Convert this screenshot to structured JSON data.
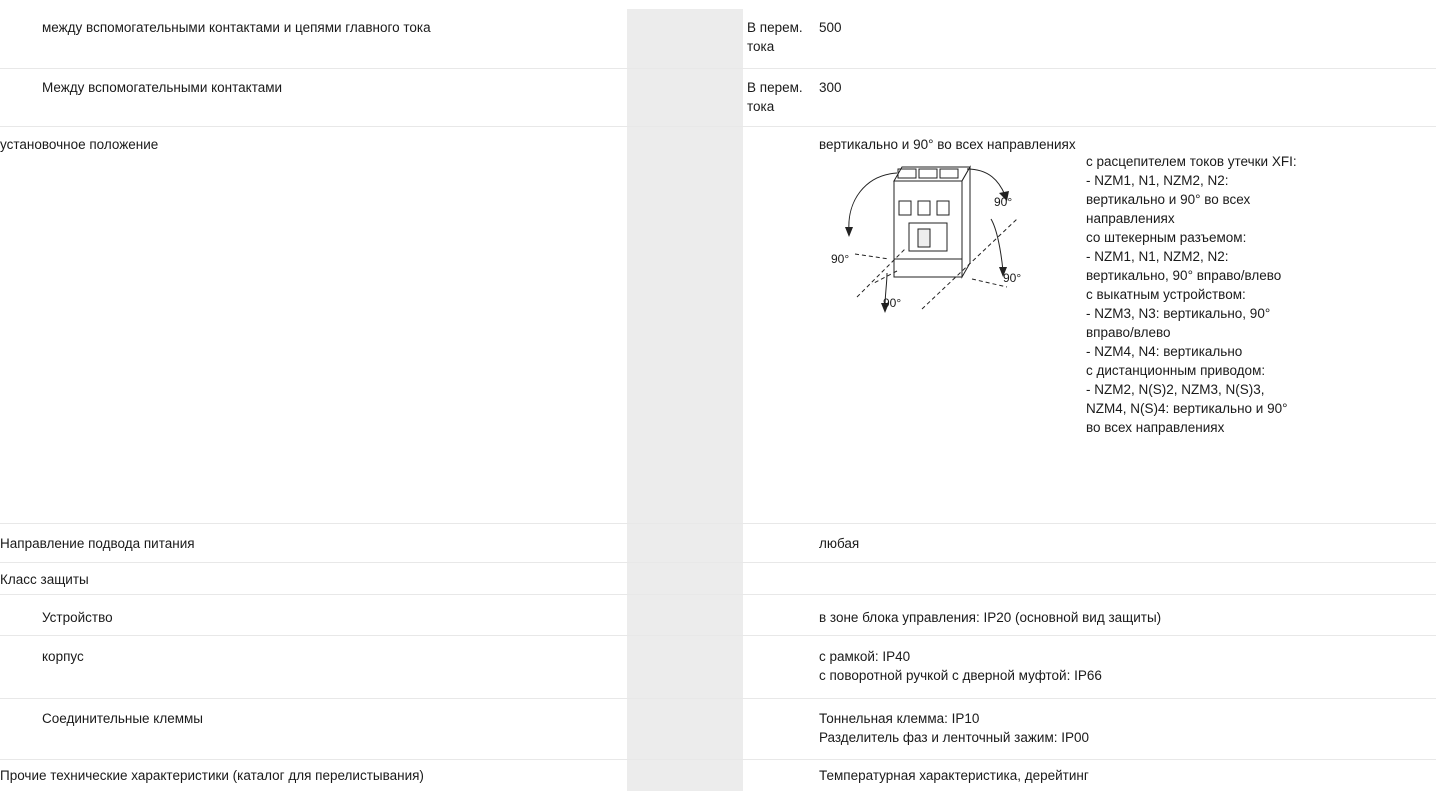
{
  "rows": {
    "r1": {
      "name": "между вспомогательными контактами и цепями главного тока",
      "unit": "В перем. тока",
      "value": "500"
    },
    "r2": {
      "name": "Между вспомогательными контактами",
      "unit": "В перем. тока",
      "value": "300"
    },
    "r3": {
      "name": "установочное положение",
      "value": "вертикально и 90° во всех направлениях",
      "diagram_labels": [
        "90°",
        "90°",
        "90°",
        "90°"
      ],
      "note": [
        "с расцепителем токов утечки XFI:",
        "- NZM1, N1, NZM2, N2:",
        "вертикально и 90° во всех",
        "направлениях",
        "со штекерным разъемом:",
        "- NZM1, N1, NZM2, N2:",
        "вертикально, 90° вправо/влево",
        "с выкатным устройством:",
        "- NZM3, N3: вертикально, 90°",
        "вправо/влево",
        "- NZM4, N4: вертикально",
        "с дистанционным приводом:",
        "- NZM2, N(S)2, NZM3, N(S)3,",
        "NZM4, N(S)4: вертикально и 90°",
        "во всех направлениях"
      ]
    },
    "r4": {
      "name": "Направление подвода питания",
      "value": "любая"
    },
    "r5": {
      "name": "Класс защиты",
      "value": ""
    },
    "r6": {
      "name": "Устройство",
      "value": "в зоне блока управления: IP20 (основной вид защиты)"
    },
    "r7": {
      "name": "корпус",
      "value": [
        "с рамкой: IP40",
        "с поворотной ручкой с дверной муфтой: IP66"
      ]
    },
    "r8": {
      "name": "Соединительные клеммы",
      "value": [
        "Тоннельная клемма: IP10",
        "Разделитель фаз и ленточный зажим: IP00"
      ]
    },
    "r9": {
      "name": "Прочие технические характеристики (каталог для перелистывания)",
      "value": "Температурная характеристика, дерейтинг"
    }
  }
}
